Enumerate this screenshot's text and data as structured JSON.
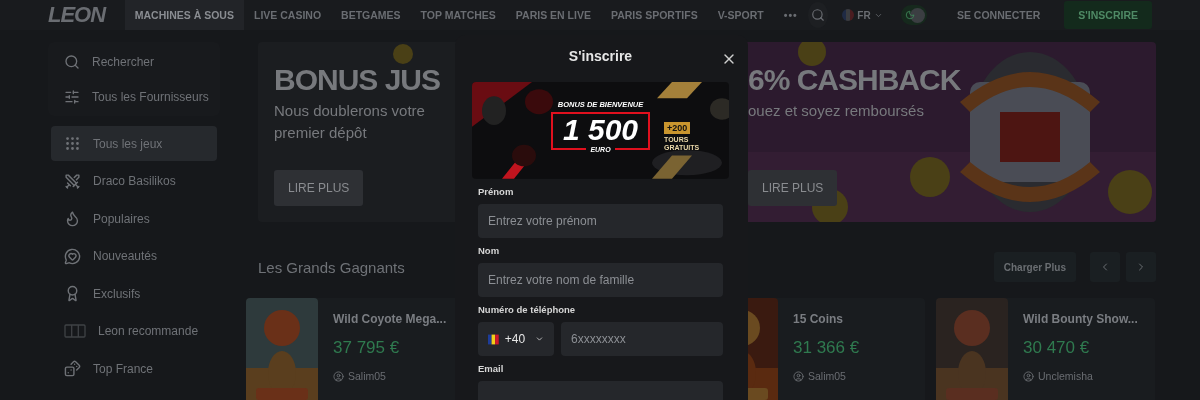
{
  "header": {
    "logo": "LEON",
    "nav": [
      {
        "label": "MACHINES À SOUS",
        "selected": true
      },
      {
        "label": "LIVE CASINO",
        "selected": false
      },
      {
        "label": "BETGAMES",
        "selected": false
      },
      {
        "label": "TOP MATCHES",
        "selected": false
      },
      {
        "label": "PARIS EN LIVE",
        "selected": false
      },
      {
        "label": "PARIS SPORTIFS",
        "selected": false
      },
      {
        "label": "V-SPORT",
        "selected": false
      }
    ],
    "more": "•••",
    "language": "FR",
    "dark_mode": true,
    "login": "SE CONNECTER",
    "signup": "S'INSCRIRE"
  },
  "sidebar": {
    "tools": [
      "Rechercher",
      "Tous les Fournisseurs"
    ],
    "items": [
      {
        "label": "Tous les jeux",
        "selected": true
      },
      {
        "label": "Draco Basilikos",
        "selected": false
      },
      {
        "label": "Populaires",
        "selected": false
      },
      {
        "label": "Nouveautés",
        "selected": false
      },
      {
        "label": "Exclusifs",
        "selected": false
      },
      {
        "label": "Leon recommande",
        "selected": false
      },
      {
        "label": "Top France",
        "selected": false
      }
    ]
  },
  "banners": [
    {
      "kind": "bonus",
      "title": "BONUS JUS",
      "subtitle": "Nous doublerons votre premier dépôt",
      "button": "LIRE PLUS"
    },
    {
      "kind": "cashback",
      "title": "6% CASHBACK",
      "subtitle": "ouez et soyez remboursés",
      "button": "LIRE PLUS"
    }
  ],
  "winners": {
    "title": "Les Grands Gagnants",
    "load_more": "Charger Plus",
    "cards": [
      {
        "title": "Wild Coyote Mega...",
        "amount": "37 795 €",
        "user": "Salim05"
      },
      {
        "title": "15 Coins",
        "amount": "31 366 €",
        "user": "Salim05"
      },
      {
        "title": "Wild Bounty Show...",
        "amount": "30 470 €",
        "user": "Unclemisha"
      }
    ]
  },
  "modal": {
    "title": "S'inscrire",
    "promo": {
      "headline": "BONUS DE BIENVENUE",
      "amount": "1 500",
      "currency": "EURO",
      "extra": "+200",
      "extra_label": "TOURS GRATUITS"
    },
    "fields": [
      {
        "kind": "text",
        "label": "Prénom",
        "placeholder": "Entrez votre prénom"
      },
      {
        "kind": "text",
        "label": "Nom",
        "placeholder": "Entrez votre nom de famille"
      },
      {
        "kind": "phone",
        "label": "Numéro de téléphone",
        "code": "+40",
        "placeholder": "6xxxxxxxx"
      },
      {
        "kind": "text",
        "label": "Email"
      }
    ]
  }
}
